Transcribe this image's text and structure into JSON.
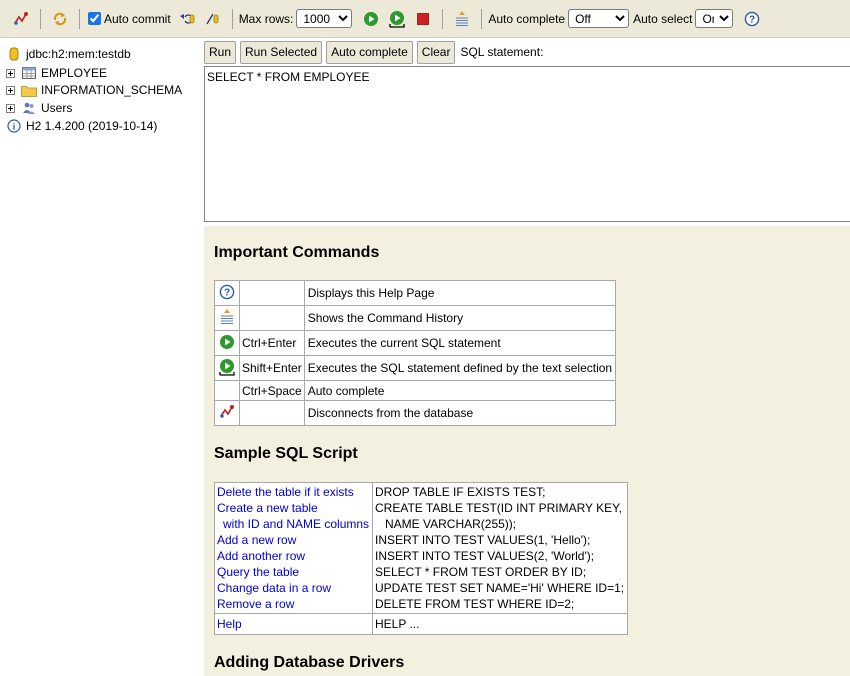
{
  "toolbar": {
    "auto_commit_label": "Auto commit",
    "auto_commit_checked": true,
    "max_rows_label": "Max rows:",
    "max_rows_value": "1000",
    "auto_complete_label": "Auto complete",
    "auto_complete_value": "Off",
    "auto_select_label": "Auto select",
    "auto_select_value": "On"
  },
  "tree": {
    "connection": "jdbc:h2:mem:testdb",
    "items": [
      {
        "label": "EMPLOYEE",
        "icon": "table-icon"
      },
      {
        "label": "INFORMATION_SCHEMA",
        "icon": "folder-icon"
      },
      {
        "label": "Users",
        "icon": "users-icon"
      }
    ],
    "version": "H2 1.4.200 (2019-10-14)"
  },
  "query": {
    "buttons": [
      "Run",
      "Run Selected",
      "Auto complete",
      "Clear"
    ],
    "sql_label": "SQL statement:",
    "sql_text": "SELECT * FROM EMPLOYEE"
  },
  "help": {
    "important_title": "Important Commands",
    "commands": [
      {
        "icon": "help-icon",
        "key": "",
        "desc": "Displays this Help Page"
      },
      {
        "icon": "history-icon",
        "key": "",
        "desc": "Shows the Command History"
      },
      {
        "icon": "run-icon",
        "key": "Ctrl+Enter",
        "desc": "Executes the current SQL statement"
      },
      {
        "icon": "run-selected-icon",
        "key": "Shift+Enter",
        "desc": "Executes the SQL statement defined by the text selection"
      },
      {
        "icon": "",
        "key": "Ctrl+Space",
        "desc": "Auto complete"
      },
      {
        "icon": "disconnect-icon",
        "key": "",
        "desc": "Disconnects from the database"
      }
    ],
    "sample_title": "Sample SQL Script",
    "sample_links": [
      "Delete the table if it exists",
      "Create a new table",
      "  with ID and NAME columns",
      "Add a new row",
      "Add another row",
      "Query the table",
      "Change data in a row",
      "Remove a row"
    ],
    "sample_code": [
      "DROP TABLE IF EXISTS TEST;",
      "CREATE TABLE TEST(ID INT PRIMARY KEY,",
      "   NAME VARCHAR(255));",
      "INSERT INTO TEST VALUES(1, 'Hello');",
      "INSERT INTO TEST VALUES(2, 'World');",
      "SELECT * FROM TEST ORDER BY ID;",
      "UPDATE TEST SET NAME='Hi' WHERE ID=1;",
      "DELETE FROM TEST WHERE ID=2;"
    ],
    "help_link": "Help",
    "help_code": "HELP ...",
    "drivers_title": "Adding Database Drivers"
  },
  "colors": {
    "toolbar_bg": "#ece9d8",
    "help_bg": "#f4f0e0",
    "link": "#0000cc",
    "run_green": "#2e9a2e",
    "stop_red": "#cc2222"
  }
}
